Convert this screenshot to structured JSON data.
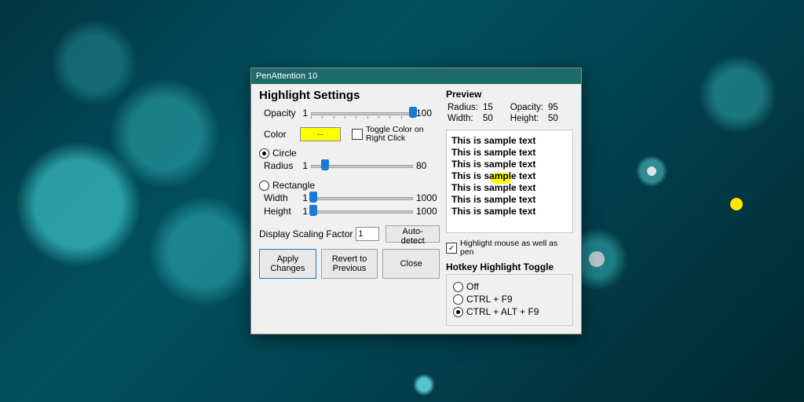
{
  "window": {
    "title": "PenAttention 10"
  },
  "heading": "Highlight Settings",
  "opacity": {
    "label": "Opacity",
    "min": "1",
    "max": "100"
  },
  "color": {
    "label": "Color",
    "button": "...",
    "toggle_label": "Toggle Color on Right Click",
    "toggle_checked": false
  },
  "shape": {
    "circle": {
      "label": "Circle",
      "selected": true,
      "radius": {
        "label": "Radius",
        "min": "1",
        "max": "80"
      }
    },
    "rectangle": {
      "label": "Rectangle",
      "selected": false,
      "width": {
        "label": "Width",
        "min": "1",
        "max": "1000"
      },
      "height": {
        "label": "Height",
        "min": "1",
        "max": "1000"
      }
    }
  },
  "scaling": {
    "label": "Display Scaling Factor",
    "value": "1",
    "auto": "Auto-detect"
  },
  "buttons": {
    "apply": "Apply Changes",
    "revert": "Revert to Previous",
    "close": "Close"
  },
  "preview": {
    "title": "Preview",
    "radius_label": "Radius:",
    "radius": "15",
    "opacity_label": "Opacity:",
    "opacity": "95",
    "width_label": "Width:",
    "width": "50",
    "height_label": "Height:",
    "height": "50",
    "sample": "This is sample text"
  },
  "hl_mouse": {
    "label": "Highlight mouse as well as pen",
    "checked": true
  },
  "hotkey": {
    "title": "Hotkey Highlight Toggle",
    "options": [
      {
        "label": "Off",
        "selected": false
      },
      {
        "label": "CTRL + F9",
        "selected": false
      },
      {
        "label": "CTRL + ALT + F9",
        "selected": true
      }
    ]
  }
}
